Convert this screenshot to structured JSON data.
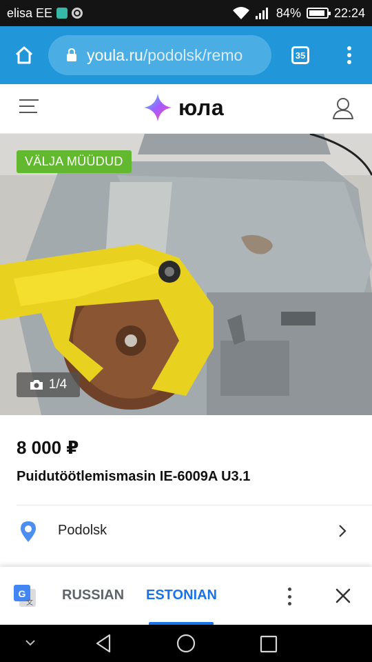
{
  "status_bar": {
    "carrier": "elisa EE",
    "battery": "84%",
    "time": "22:24"
  },
  "browser": {
    "url_host": "youla.ru",
    "url_path": "/podolsk/remo",
    "tab_count": "35"
  },
  "header": {
    "logo_text": "юла"
  },
  "listing": {
    "badge": "VÄLJA MÜÜDUD",
    "photo_counter": "1/4",
    "price": "8 000 ₽",
    "title": "Puidutöötlemismasin IE-6009A U3.1",
    "location": "Podolsk"
  },
  "translate_bar": {
    "source_language": "RUSSIAN",
    "target_language": "ESTONIAN"
  },
  "colors": {
    "browser_bar": "#2196d8",
    "sold_badge": "#62b82f",
    "active_language": "#1a73e8",
    "location_pin": "#4d8ff0"
  },
  "icons": [
    "wifi-icon",
    "signal-icon",
    "battery-icon",
    "home-icon",
    "lock-icon",
    "tabs-icon",
    "more-vert-icon",
    "hamburger-icon",
    "youla-logo-icon",
    "profile-icon",
    "camera-icon",
    "location-pin-icon",
    "chevron-right-icon",
    "google-translate-icon",
    "close-icon",
    "back-icon",
    "home-circle-icon",
    "recents-icon"
  ]
}
